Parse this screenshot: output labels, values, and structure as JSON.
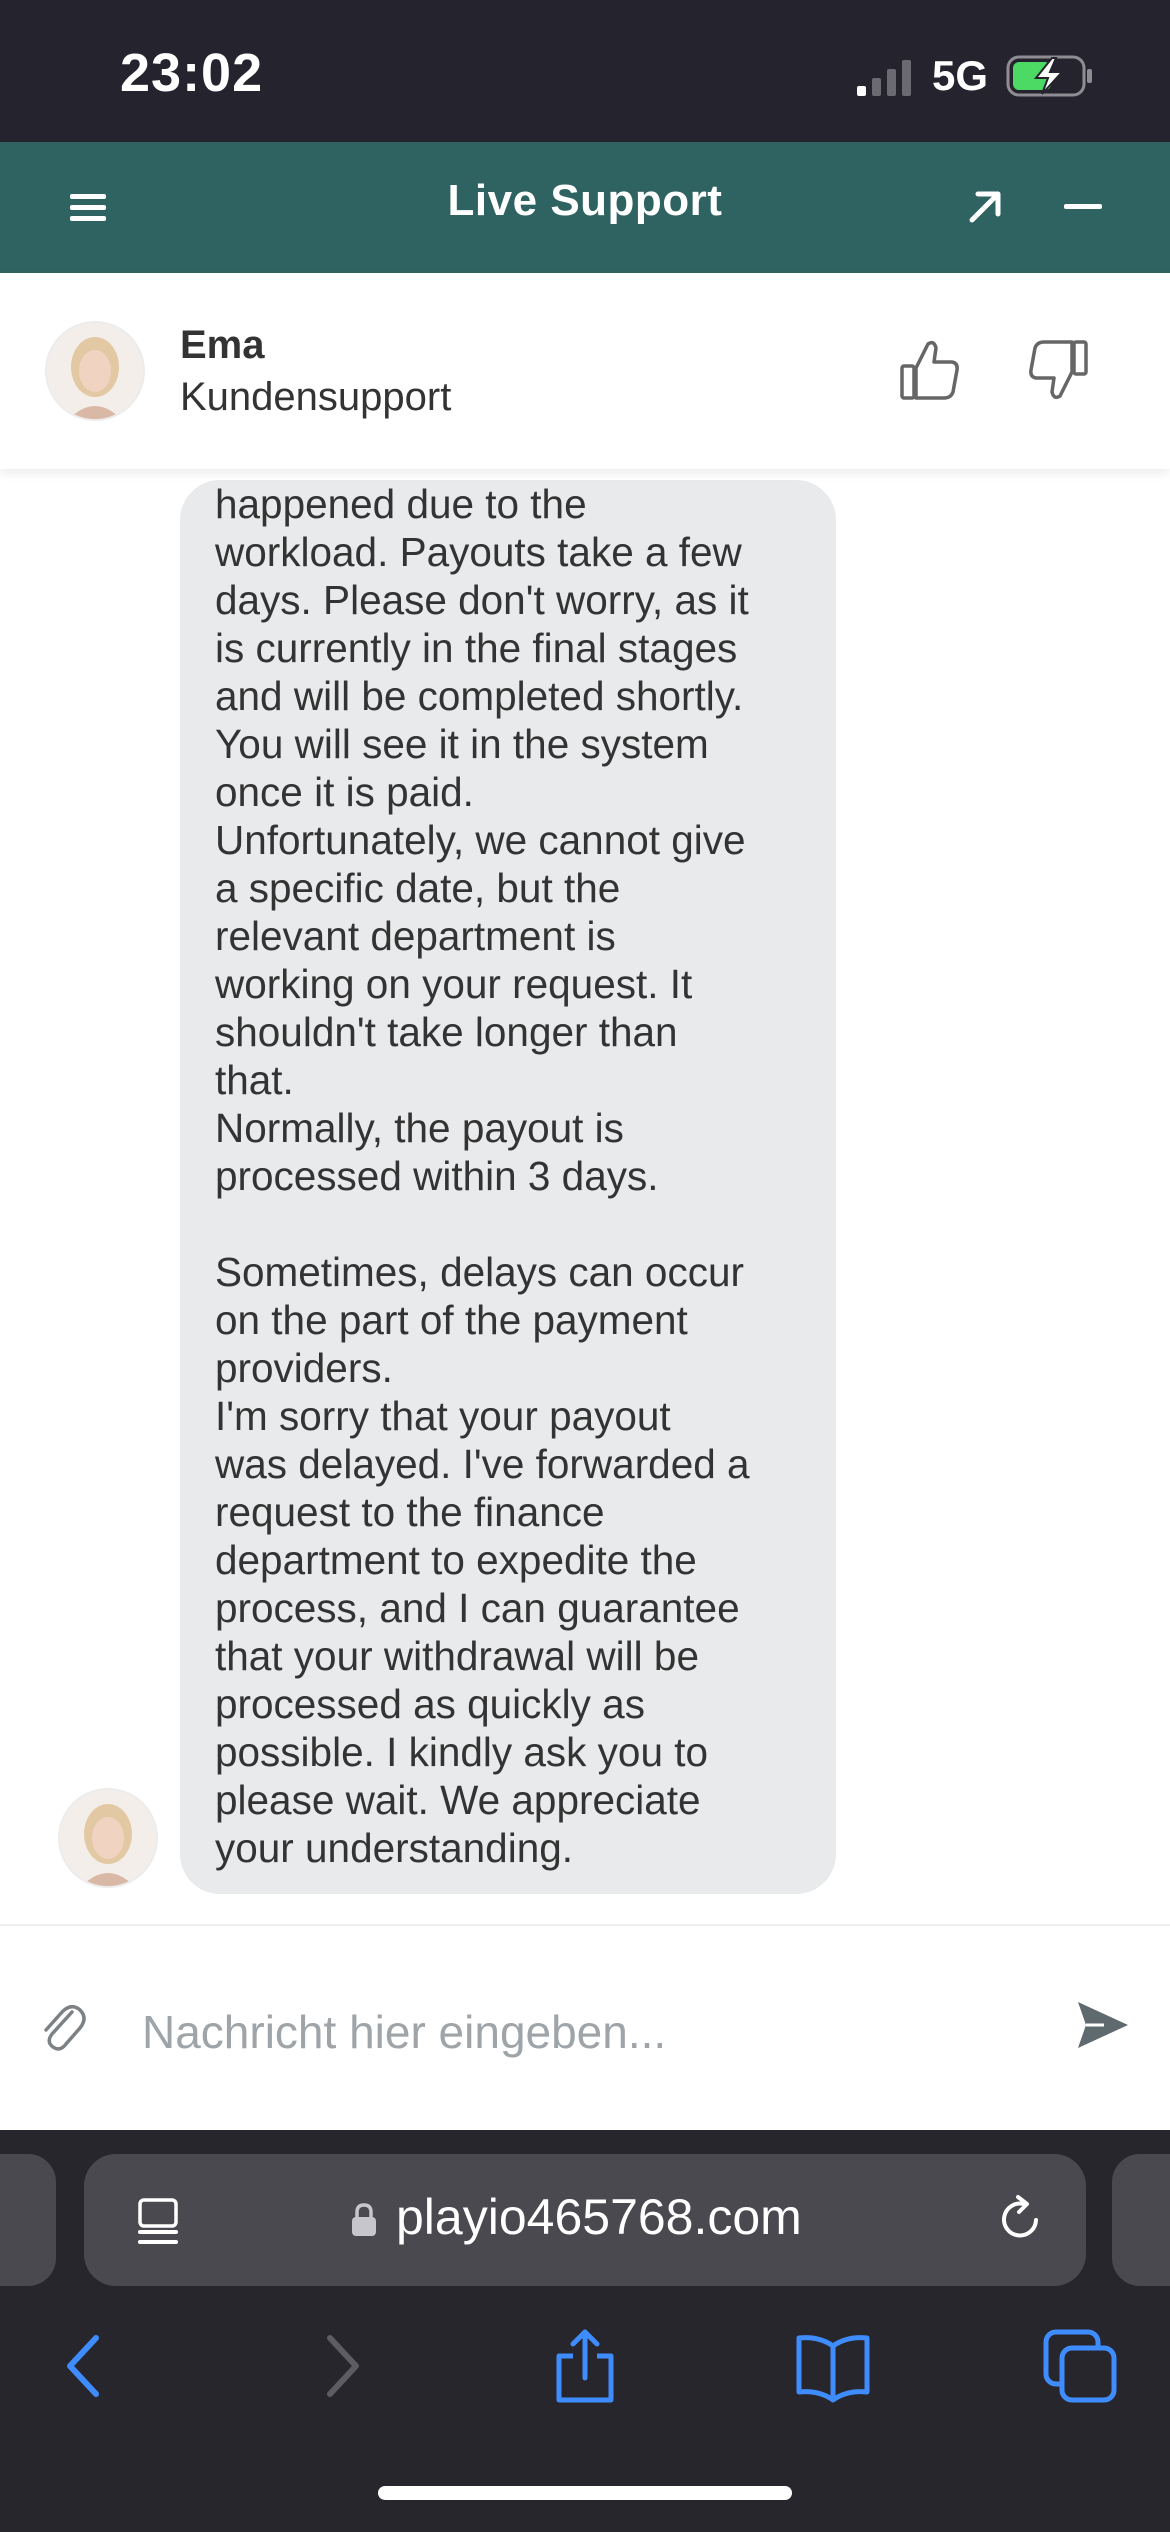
{
  "status_bar": {
    "time": "23:02",
    "network": "5G",
    "battery_state": "charging"
  },
  "header": {
    "title": "Live Support",
    "icons": [
      "menu-icon",
      "popout-arrow-icon",
      "minimize-icon"
    ],
    "background_color": "#2f6361"
  },
  "agent": {
    "name": "Ema",
    "role": "Kundensupport",
    "rating_icons": [
      "thumbs-up-icon",
      "thumbs-down-icon"
    ]
  },
  "chat": {
    "messages": [
      {
        "sender": "agent",
        "text": "happened due to the\nworkload. Payouts take a few\ndays. Please don't worry, as it\nis currently in the final stages\nand will be completed shortly.\nYou will see it in the system\nonce it is paid.\nUnfortunately, we cannot give\na specific date, but the\nrelevant department is\nworking on your request. It\nshouldn't take longer than\nthat.\nNormally, the payout is\nprocessed within 3 days.\n\nSometimes, delays can occur\non the part of the payment\nproviders.\nI'm sorry that your payout\nwas delayed. I've forwarded a\nrequest to the finance\ndepartment to expedite the\nprocess, and I can guarantee\nthat your withdrawal will be\nprocessed as quickly as\npossible. I kindly ask you to\nplease wait. We appreciate\nyour understanding."
      }
    ]
  },
  "composer": {
    "placeholder": "Nachricht hier eingeben...",
    "value": ""
  },
  "browser": {
    "url": "playio465768.com",
    "toolbar_icons": [
      "back-icon",
      "forward-icon",
      "share-icon",
      "bookmarks-icon",
      "tabs-icon"
    ]
  }
}
